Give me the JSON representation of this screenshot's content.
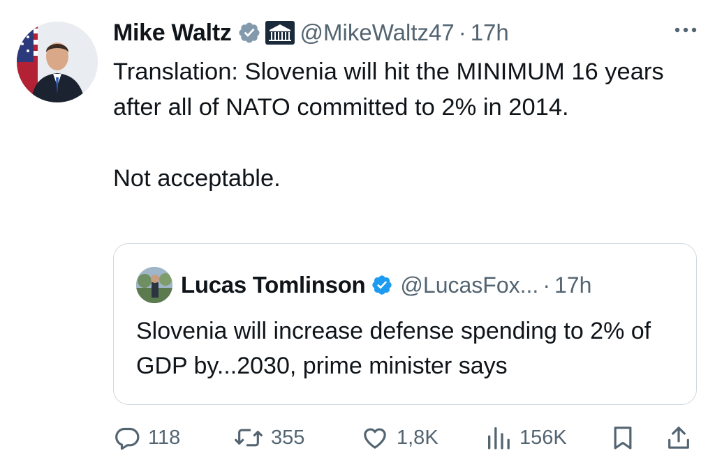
{
  "tweet": {
    "author": {
      "name": "Mike Waltz",
      "handle": "@MikeWaltz47",
      "time": "17h",
      "badges": [
        "verified-badge-icon",
        "government-building-badge-icon"
      ]
    },
    "separator": "·",
    "text": "Translation: Slovenia will hit the MINIMUM 16 years after all of NATO committed to 2% in 2014.\n\nNot acceptable.",
    "quote": {
      "author": {
        "name": "Lucas Tomlinson",
        "handle": "@LucasFox...",
        "time": "17h"
      },
      "text": "Slovenia will increase defense spending to 2% of GDP by...2030, prime minister says"
    },
    "actions": {
      "replies": "118",
      "reposts": "355",
      "likes": "1,8K",
      "views": "156K"
    }
  },
  "colors": {
    "text": "#0f1419",
    "secondary": "#536471",
    "verified": "#1d9bf0",
    "border": "#cfd9de"
  },
  "icons": {
    "more": "more-dots-icon",
    "reply": "reply-bubble-icon",
    "repost": "repost-arrows-icon",
    "like": "heart-icon",
    "views": "views-bars-icon",
    "bookmark": "bookmark-icon",
    "share": "share-icon"
  }
}
